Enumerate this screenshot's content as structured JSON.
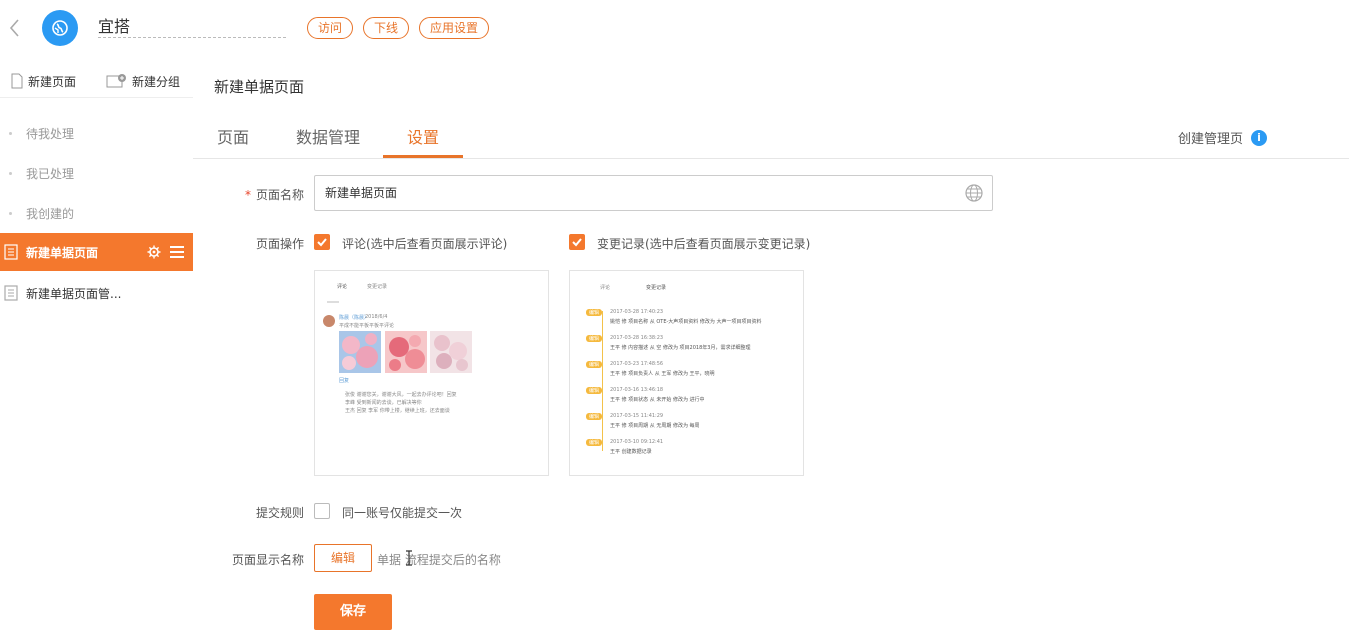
{
  "topbar": {
    "app_name": "宜搭",
    "buttons": [
      "访问",
      "下线",
      "应用设置"
    ]
  },
  "sidebar": {
    "actions": {
      "new_page": "新建页面",
      "new_group": "新建分组"
    },
    "items": [
      {
        "label": "待我处理"
      },
      {
        "label": "我已处理"
      },
      {
        "label": "我创建的"
      },
      {
        "label": "新建单据页面"
      },
      {
        "label": "新建单据页面管..."
      }
    ]
  },
  "main": {
    "heading": "新建单据页面",
    "tabs": [
      "页面",
      "数据管理",
      "设置"
    ],
    "active_tab": "设置",
    "create_manager": "创建管理页",
    "form": {
      "page_name_label": "页面名称",
      "page_name_value": "新建单据页面",
      "page_ops_label": "页面操作",
      "op_comment": "评论(选中后查看页面展示评论)",
      "op_changelog": "变更记录(选中后查看页面展示变更记录)",
      "submit_rule_label": "提交规则",
      "submit_rule_option": "同一账号仅能提交一次",
      "display_name_label": "页面显示名称",
      "edit_button": "编辑",
      "display_hint": "单据    流程提交后的名称",
      "save_button": "保存"
    },
    "preview_comment": {
      "tab1": "评论",
      "tab2": "变更记录",
      "user": "陈晨（陈晨）",
      "time": "2018/6/4",
      "text": "平成不能平板平板平评论",
      "reply": "回复",
      "lines": [
        "张俊    谢谢您关，谢谢大风，一起去办评论吧！回复",
        "李峰    受到新闻的去谈，已解决等你",
        "王杰 回复 李军    你带上楼，继续上班，还去面谈"
      ]
    },
    "preview_changelog": {
      "tab1": "评论",
      "tab2": "变更记录",
      "entries": [
        {
          "tag": "编辑",
          "date": "2017-03-28 17:40:23",
          "text": "姚恺 修 项目名称 从 OTE-大声项目资料 修改为 大声一项目项目资料"
        },
        {
          "tag": "编辑",
          "date": "2017-03-28 16:38:23",
          "text": "王平 修 内容描述 从 空 修改为 项目2018年3月，需求详细整理"
        },
        {
          "tag": "编辑",
          "date": "2017-03-23 17:48:56",
          "text": "王平 修 项目负责人 从 王军 修改为 王平，晓明"
        },
        {
          "tag": "编辑",
          "date": "2017-03-16 13:46:18",
          "text": "王平 修 项目状态 从 未开始 修改为 进行中"
        },
        {
          "tag": "编辑",
          "date": "2017-03-15 11:41:29",
          "text": "王平 修 项目周期 从 无周期 修改为 每周"
        },
        {
          "tag": "编辑",
          "date": "2017-03-10 09:12:41",
          "text": "王平 创建数据记录"
        }
      ]
    }
  },
  "colors": {
    "accent": "#f4782d",
    "blue": "#2b9af3"
  }
}
